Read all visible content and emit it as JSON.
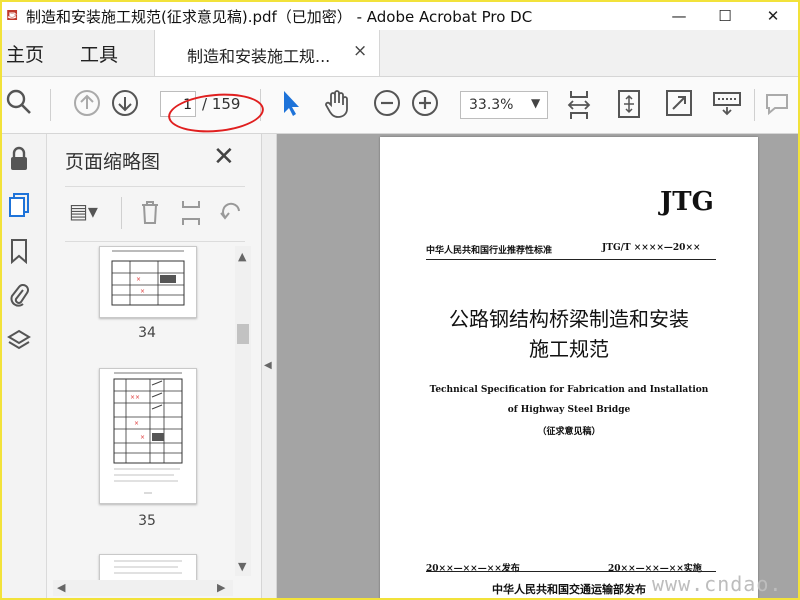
{
  "window": {
    "title": "制造和安装施工规范(征求意见稿).pdf（已加密） - Adobe Acrobat Pro DC",
    "minimize_glyph": "—",
    "maximize_glyph": "☐",
    "close_glyph": "✕"
  },
  "menu": {
    "home_label": "主页",
    "tools_label": "工具"
  },
  "doc_tab": {
    "label": "制造和安装施工规...",
    "close_glyph": "×"
  },
  "toolbar": {
    "page_value": "1",
    "page_total": "/ 159",
    "zoom_value": "33.3%",
    "icons": [
      "search-icon",
      "previous-page-icon",
      "next-page-icon",
      "select-cursor-icon",
      "hand-tool-icon",
      "zoom-out-icon",
      "zoom-in-icon",
      "fit-page-icon",
      "scroll-mode-icon",
      "fullscreen-icon",
      "keyboard-icon",
      "comment-icon"
    ]
  },
  "leftrail": {
    "icons": [
      "lock-icon",
      "pages-icon",
      "bookmark-icon",
      "attachment-icon",
      "layers-icon"
    ]
  },
  "thumbnail_panel": {
    "title": "页面缩略图",
    "close_glyph": "✕",
    "thumbnails": [
      {
        "label": "34"
      },
      {
        "label": "35"
      }
    ]
  },
  "document_page": {
    "code": "JTG",
    "standard_category": "中华人民共和国行业推荐性标准",
    "standard_number": "JTG/T ××××—20××",
    "title_line1": "公路钢结构桥梁制造和安装",
    "title_line2": "施工规范",
    "en_title_line1": "Technical Specification for Fabrication and Installation",
    "en_title_line2": "of Highway Steel Bridge",
    "draft_note": "（征求意见稿）",
    "publish_date": "20××—××—××发布",
    "effective_date": "20××—××—××实施",
    "publisher": "中华人民共和国交通运输部发布"
  },
  "watermark": "www.cndao."
}
